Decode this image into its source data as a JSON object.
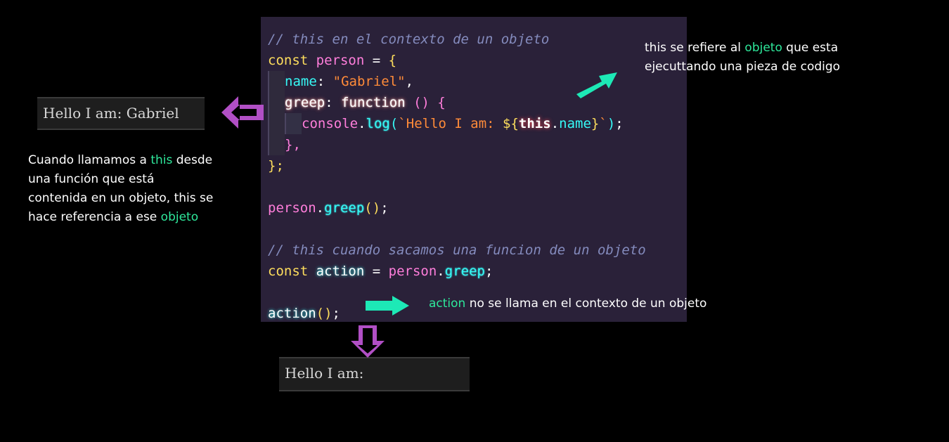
{
  "colors": {
    "background": "#000000",
    "editor_bg": "#2a2139",
    "arrow_green": "#1de9b6",
    "arrow_purple": "#b14fc5",
    "highlight_green": "#2ee89b"
  },
  "code": {
    "comment1": "// this en el contexto de un objeto",
    "kw_const": "const",
    "person": "person",
    "eq": "=",
    "open_brace": "{",
    "name_prop": "name",
    "name_value": "\"Gabriel\"",
    "greep_prop": "greep",
    "function_kw": "function",
    "parens": "()",
    "console": "console",
    "log": "log",
    "template_text": "`Hello I am: ",
    "dollar": "${",
    "this_kw": "this",
    "dot_name": "name",
    "close_tpl": "}`",
    "close_inner": "},",
    "close_outer": "};",
    "call1_obj": "person",
    "call1_fn": "greep",
    "comment2": "// this cuando sacamos una funcion de un objeto",
    "action": "action"
  },
  "outputs": {
    "first": "Hello I am: Gabriel",
    "second": "Hello I am:"
  },
  "annotations": {
    "top_right_1a": "this se refiere al ",
    "top_right_1b": "objeto",
    "top_right_1c": " que esta",
    "top_right_2": "ejecuttando una pieza de codigo",
    "left_1a": "Cuando llamamos a ",
    "left_1b": "this",
    "left_1c": " desde",
    "left_2": "una función que está",
    "left_3": "contenida en un objeto, this se",
    "left_4a": "hace referencia a ese ",
    "left_4b": "objeto",
    "bottom_a": "action",
    "bottom_b": " no se llama en  el contexto de un objeto"
  }
}
